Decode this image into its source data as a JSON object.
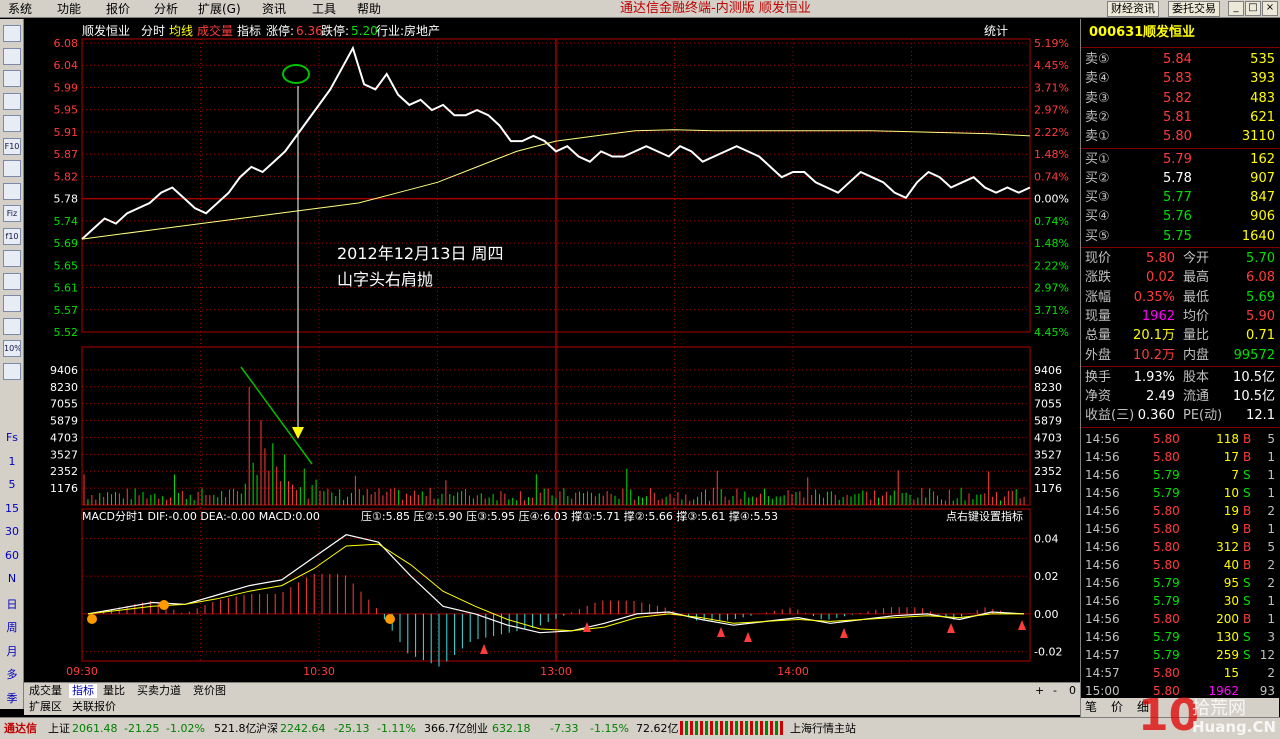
{
  "menu": [
    "系统",
    "功能",
    "报价",
    "分析",
    "扩展(G)",
    "资讯",
    "工具",
    "帮助"
  ],
  "app_title": "通达信金融终端-内测版  顺发恒业",
  "top_buttons": [
    "财经资讯",
    "委托交易"
  ],
  "window_buttons": [
    "_",
    "□",
    "×"
  ],
  "toolbar_icons": [
    "report-icon",
    "grid-icon",
    "kline-icon",
    "candle-icon",
    "list-icon",
    "f10-icon",
    "info-icon",
    "note-icon",
    "fiz-icon",
    "f10b-icon",
    "search-icon",
    "chart-a-icon",
    "chart-b-icon",
    "chart-c-icon",
    "percent-icon",
    "pencil-icon"
  ],
  "toolbar_labels": [
    "",
    "",
    "",
    "",
    "",
    "F10",
    "",
    "",
    "Fiz",
    "f10",
    "",
    "",
    "",
    "",
    "10%",
    ""
  ],
  "periods": [
    "Fs",
    "1",
    "5",
    "15",
    "30",
    "60",
    "N",
    "日",
    "周",
    "月",
    "多",
    "季"
  ],
  "chart_header": {
    "name": "顺发恒业",
    "items": [
      "分时",
      "均线"
    ],
    "vol_label": "成交量",
    "indicator": "指标",
    "limit_up_label": "涨停:",
    "limit_up": "6.36",
    "limit_down_label": "跌停:",
    "limit_down": "5.20",
    "industry": "行业:房地产",
    "stats": "统计"
  },
  "annotation": {
    "line1": "2012年12月13日  周四",
    "line2": "山字头右肩抛"
  },
  "price_axis": {
    "prices": [
      "6.08",
      "6.04",
      "5.99",
      "5.95",
      "5.91",
      "5.87",
      "5.82",
      "5.78",
      "5.74",
      "5.69",
      "5.65",
      "5.61",
      "5.57",
      "5.52"
    ],
    "percents": [
      "5.19%",
      "4.45%",
      "3.71%",
      "2.97%",
      "2.22%",
      "1.48%",
      "0.74%",
      "0.00%",
      "0.74%",
      "1.48%",
      "2.22%",
      "2.97%",
      "3.71%",
      "4.45%"
    ]
  },
  "volume_axis": [
    "9406",
    "8230",
    "7055",
    "5879",
    "4703",
    "3527",
    "2352",
    "1176"
  ],
  "macd": {
    "header": "MACD分时1  DIF:-0.00  DEA:-0.00  MACD:0.00",
    "levels": "压①:5.85  压②:5.90  压③:5.95  压④:6.03  撑①:5.71  撑②:5.66  撑③:5.61  撑④:5.53",
    "hint": "点右键设置指标",
    "axis": [
      "0.04",
      "0.02",
      "0.00",
      "-0.02"
    ]
  },
  "time_axis": [
    "09:30",
    "10:30",
    "13:00",
    "14:00"
  ],
  "bottom_tabs": [
    "成交量",
    "指标",
    "量比",
    "买卖力道",
    "竞价图"
  ],
  "bottom_tools": [
    "+",
    "-",
    "0"
  ],
  "ext_tabs": [
    "扩展区",
    "关联报价"
  ],
  "stock": {
    "code": "000631",
    "name": "顺发恒业"
  },
  "order_book": {
    "sells": [
      {
        "label": "卖⑤",
        "price": "5.84",
        "vol": "535"
      },
      {
        "label": "卖④",
        "price": "5.83",
        "vol": "393"
      },
      {
        "label": "卖③",
        "price": "5.82",
        "vol": "483"
      },
      {
        "label": "卖②",
        "price": "5.81",
        "vol": "621"
      },
      {
        "label": "卖①",
        "price": "5.80",
        "vol": "3110"
      }
    ],
    "buys": [
      {
        "label": "买①",
        "price": "5.79",
        "vol": "162"
      },
      {
        "label": "买②",
        "price": "5.78",
        "vol": "907"
      },
      {
        "label": "买③",
        "price": "5.77",
        "vol": "847"
      },
      {
        "label": "买④",
        "price": "5.76",
        "vol": "906"
      },
      {
        "label": "买⑤",
        "price": "5.75",
        "vol": "1640"
      }
    ]
  },
  "quote": [
    {
      "l1": "现价",
      "v1": "5.80",
      "l2": "今开",
      "v2": "5.70"
    },
    {
      "l1": "涨跌",
      "v1": "0.02",
      "l2": "最高",
      "v2": "6.08"
    },
    {
      "l1": "涨幅",
      "v1": "0.35%",
      "l2": "最低",
      "v2": "5.69"
    },
    {
      "l1": "现量",
      "v1": "1962",
      "l2": "均价",
      "v2": "5.90"
    },
    {
      "l1": "总量",
      "v1": "20.1万",
      "l2": "量比",
      "v2": "0.71"
    },
    {
      "l1": "外盘",
      "v1": "10.2万",
      "l2": "内盘",
      "v2": "99572"
    }
  ],
  "fundamentals": [
    {
      "l1": "换手",
      "v1": "1.93%",
      "l2": "股本",
      "v2": "10.5亿"
    },
    {
      "l1": "净资",
      "v1": "2.49",
      "l2": "流通",
      "v2": "10.5亿"
    },
    {
      "l1": "收益(三)",
      "v1": "0.360",
      "l2": "PE(动)",
      "v2": "12.1"
    }
  ],
  "ticks": [
    {
      "t": "14:56",
      "p": "5.80",
      "v": "118",
      "s": "B",
      "n": "5"
    },
    {
      "t": "14:56",
      "p": "5.80",
      "v": "17",
      "s": "B",
      "n": "1"
    },
    {
      "t": "14:56",
      "p": "5.79",
      "v": "7",
      "s": "S",
      "n": "1"
    },
    {
      "t": "14:56",
      "p": "5.79",
      "v": "10",
      "s": "S",
      "n": "1"
    },
    {
      "t": "14:56",
      "p": "5.80",
      "v": "19",
      "s": "B",
      "n": "2"
    },
    {
      "t": "14:56",
      "p": "5.80",
      "v": "9",
      "s": "B",
      "n": "1"
    },
    {
      "t": "14:56",
      "p": "5.80",
      "v": "312",
      "s": "B",
      "n": "5"
    },
    {
      "t": "14:56",
      "p": "5.80",
      "v": "40",
      "s": "B",
      "n": "2"
    },
    {
      "t": "14:56",
      "p": "5.79",
      "v": "95",
      "s": "S",
      "n": "2"
    },
    {
      "t": "14:56",
      "p": "5.79",
      "v": "30",
      "s": "S",
      "n": "1"
    },
    {
      "t": "14:56",
      "p": "5.80",
      "v": "200",
      "s": "B",
      "n": "1"
    },
    {
      "t": "14:56",
      "p": "5.79",
      "v": "130",
      "s": "S",
      "n": "3"
    },
    {
      "t": "14:57",
      "p": "5.79",
      "v": "259",
      "s": "S",
      "n": "12"
    },
    {
      "t": "14:57",
      "p": "5.80",
      "v": "15",
      "s": "",
      "n": "2"
    },
    {
      "t": "15:00",
      "p": "5.80",
      "v": "1962",
      "s": "",
      "n": "93"
    }
  ],
  "right_tabs": [
    "笔",
    "价",
    "细"
  ],
  "status": {
    "sh_label": "上证",
    "sh": "2061.48",
    "sh_chg": "-21.25",
    "sh_pct": "-1.02%",
    "sh_amt": "521.8亿",
    "hs_label": "沪深",
    "hs": "2242.64",
    "hs_chg": "-25.13",
    "hs_pct": "-1.11%",
    "hs_amt": "366.7亿",
    "cy_label": "创业",
    "cy": "632.18",
    "cy_chg": "-7.33",
    "cy_pct": "-1.15%",
    "cy_amt": "72.62亿",
    "server": "上海行情主站",
    "brand": "通达信"
  },
  "watermark": "10拾荒网 Huang.CN",
  "chart_data": {
    "type": "line",
    "x_range": [
      "09:30",
      "15:00"
    ],
    "price_ylim": [
      5.52,
      6.08
    ],
    "prev_close": 5.78,
    "price": [
      5.7,
      5.72,
      5.74,
      5.73,
      5.75,
      5.76,
      5.77,
      5.79,
      5.8,
      5.78,
      5.76,
      5.75,
      5.77,
      5.79,
      5.82,
      5.84,
      5.83,
      5.85,
      5.87,
      5.9,
      5.93,
      5.96,
      5.99,
      6.03,
      6.07,
      6.0,
      5.99,
      6.02,
      5.98,
      5.96,
      5.97,
      5.95,
      5.96,
      5.94,
      5.94,
      5.95,
      5.94,
      5.92,
      5.89,
      5.89,
      5.9,
      5.89,
      5.87,
      5.88,
      5.86,
      5.85,
      5.87,
      5.86,
      5.86,
      5.87,
      5.88,
      5.87,
      5.86,
      5.88,
      5.87,
      5.85,
      5.86,
      5.87,
      5.88,
      5.87,
      5.86,
      5.84,
      5.82,
      5.83,
      5.83,
      5.81,
      5.8,
      5.79,
      5.81,
      5.83,
      5.82,
      5.81,
      5.79,
      5.78,
      5.81,
      5.83,
      5.82,
      5.8,
      5.81,
      5.82,
      5.8,
      5.79,
      5.8,
      5.79,
      5.8
    ],
    "avg": [
      5.7,
      5.71,
      5.72,
      5.73,
      5.74,
      5.75,
      5.76,
      5.77,
      5.79,
      5.81,
      5.84,
      5.87,
      5.89,
      5.9,
      5.91,
      5.912,
      5.91,
      5.91,
      5.91,
      5.91,
      5.91,
      5.908,
      5.906,
      5.904,
      5.9
    ],
    "volume_ylim": [
      0,
      10582
    ],
    "volume_peaks": [
      8230,
      5900,
      4300,
      3527,
      2500,
      1800
    ],
    "macd_ylim": [
      -0.025,
      0.045
    ],
    "dif": [
      0.0,
      0.003,
      0.006,
      0.005,
      0.01,
      0.015,
      0.018,
      0.03,
      0.042,
      0.038,
      0.02,
      0.004,
      0.0,
      -0.006,
      -0.01,
      -0.009,
      -0.005,
      0.0,
      0.001,
      -0.003,
      -0.006,
      -0.004,
      -0.002,
      -0.005,
      -0.003,
      -0.001,
      0.0,
      -0.003,
      0.001,
      0.0
    ],
    "dea": [
      0.0,
      0.002,
      0.004,
      0.005,
      0.008,
      0.012,
      0.015,
      0.024,
      0.036,
      0.037,
      0.026,
      0.012,
      0.004,
      -0.003,
      -0.008,
      -0.009,
      -0.007,
      -0.002,
      0.0,
      -0.002,
      -0.005,
      -0.004,
      -0.003,
      -0.004,
      -0.003,
      -0.002,
      -0.001,
      -0.002,
      0.0,
      0.0
    ]
  }
}
